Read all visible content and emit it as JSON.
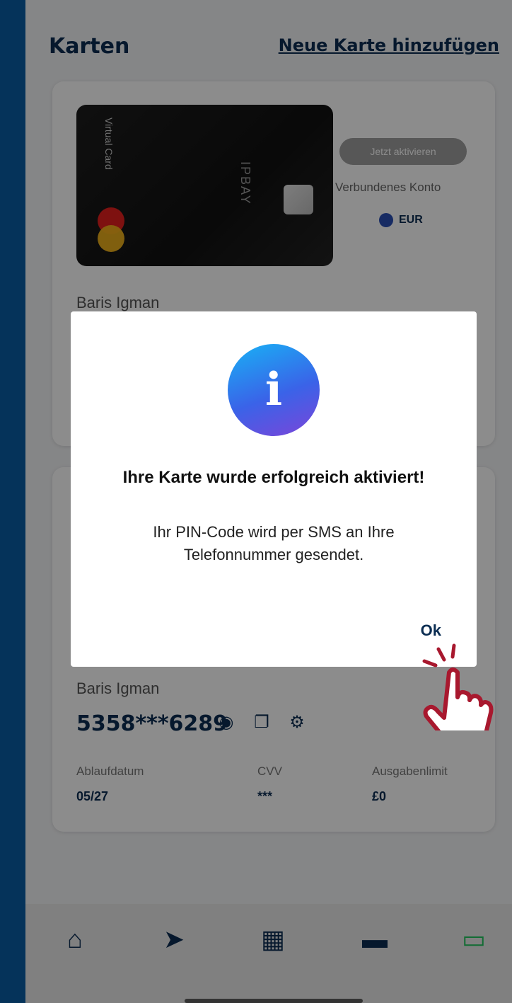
{
  "header": {
    "title": "Karten",
    "add_card_link": "Neue Karte hinzufügen"
  },
  "card1": {
    "virtual_label": "Virtual Card",
    "brand_text": "IPBAY",
    "activate_button": "Jetzt aktivieren",
    "linked_account_label": "Verbundenes Konto",
    "currency": "EUR",
    "holder": "Baris Igman"
  },
  "card2": {
    "holder": "Baris Igman",
    "pan": "5358***6289",
    "expiry_label": "Ablaufdatum",
    "expiry_value": "05/27",
    "cvv_label": "CVV",
    "cvv_value": "***",
    "limit_label": "Ausgabenlimit",
    "limit_value": "£0"
  },
  "dialog": {
    "title": "Ihre Karte wurde erfolgreich aktiviert!",
    "message": "Ihr PIN-Code wird per SMS an Ihre Telefonnummer gesendet.",
    "ok_button": "Ok"
  },
  "navbar": {
    "items": [
      {
        "icon": "home-icon"
      },
      {
        "icon": "send-icon"
      },
      {
        "icon": "qr-code-icon"
      },
      {
        "icon": "wallet-icon"
      },
      {
        "icon": "card-icon",
        "active": true
      }
    ]
  },
  "colors": {
    "primary": "#0b2d52",
    "accent_active": "#22c55e",
    "sidebar": "#05335a"
  }
}
